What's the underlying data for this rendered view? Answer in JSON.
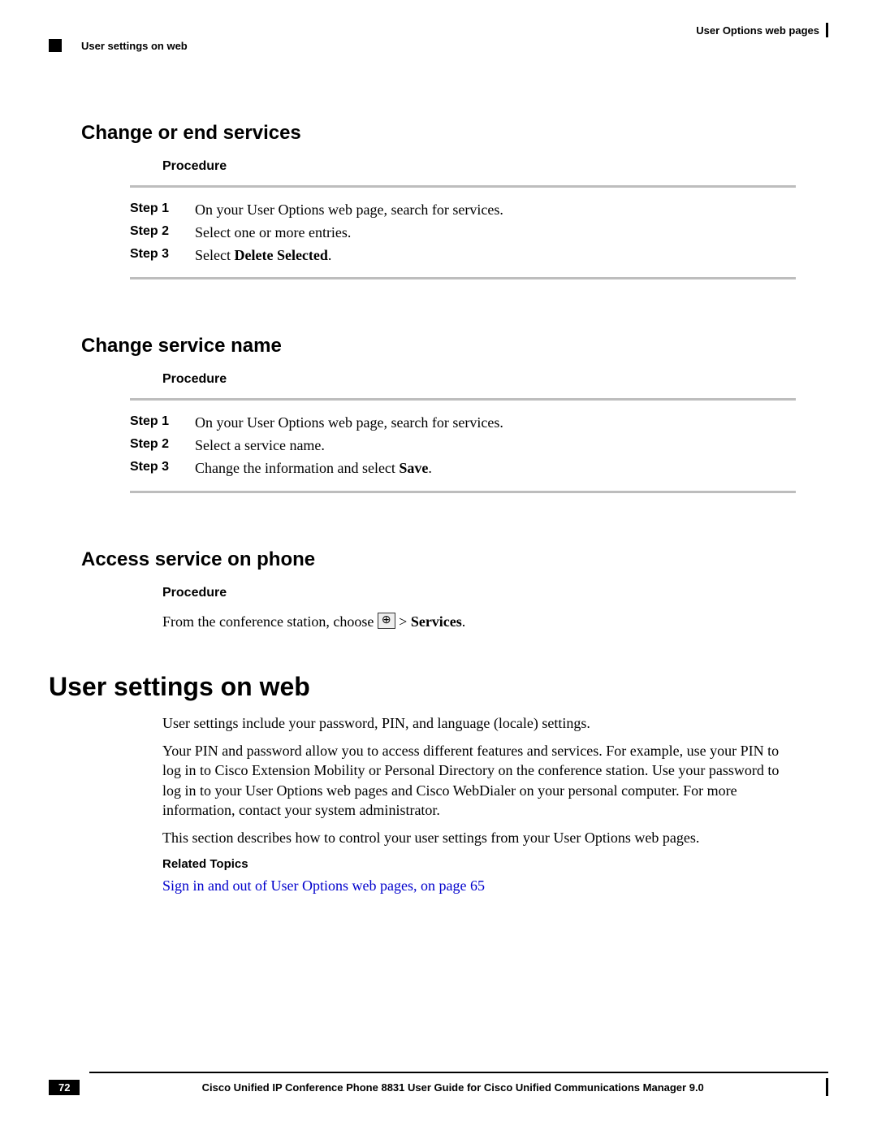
{
  "header": {
    "right_text": "User Options web pages",
    "left_text": "User settings on web"
  },
  "sections": {
    "s1": {
      "title": "Change or end services",
      "procedure_label": "Procedure",
      "steps": {
        "l1": "Step 1",
        "t1": "On your User Options web page, search for services.",
        "l2": "Step 2",
        "t2": "Select one or more entries.",
        "l3": "Step 3",
        "t3_pre": "Select ",
        "t3_bold": "Delete Selected",
        "t3_post": "."
      }
    },
    "s2": {
      "title": "Change service name",
      "procedure_label": "Procedure",
      "steps": {
        "l1": "Step 1",
        "t1": "On your User Options web page, search for services.",
        "l2": "Step 2",
        "t2": "Select a service name.",
        "l3": "Step 3",
        "t3_pre": "Change the information and select ",
        "t3_bold": "Save",
        "t3_post": "."
      }
    },
    "s3": {
      "title": "Access service on phone",
      "procedure_label": "Procedure",
      "body_pre": "From the conference station, choose ",
      "icon_name": "globe-icon",
      "icon_glyph": "⊕",
      "body_mid": " > ",
      "body_bold": "Services",
      "body_post": "."
    },
    "main": {
      "title": "User settings on web",
      "p1": "User settings include your password, PIN, and language (locale) settings.",
      "p2": "Your PIN and password allow you to access different features and services. For example, use your PIN to log in to Cisco Extension Mobility or Personal Directory on the conference station. Use your password to log in to your User Options web pages and Cisco WebDialer on your personal computer. For more information, contact your system administrator.",
      "p3": "This section describes how to control your user settings from your User Options web pages.",
      "related_label": "Related Topics",
      "link_text": "Sign in and out of User Options web pages,  on page 65"
    }
  },
  "footer": {
    "page_number": "72",
    "book_title": "Cisco Unified IP Conference Phone 8831 User Guide for Cisco Unified Communications Manager 9.0"
  }
}
